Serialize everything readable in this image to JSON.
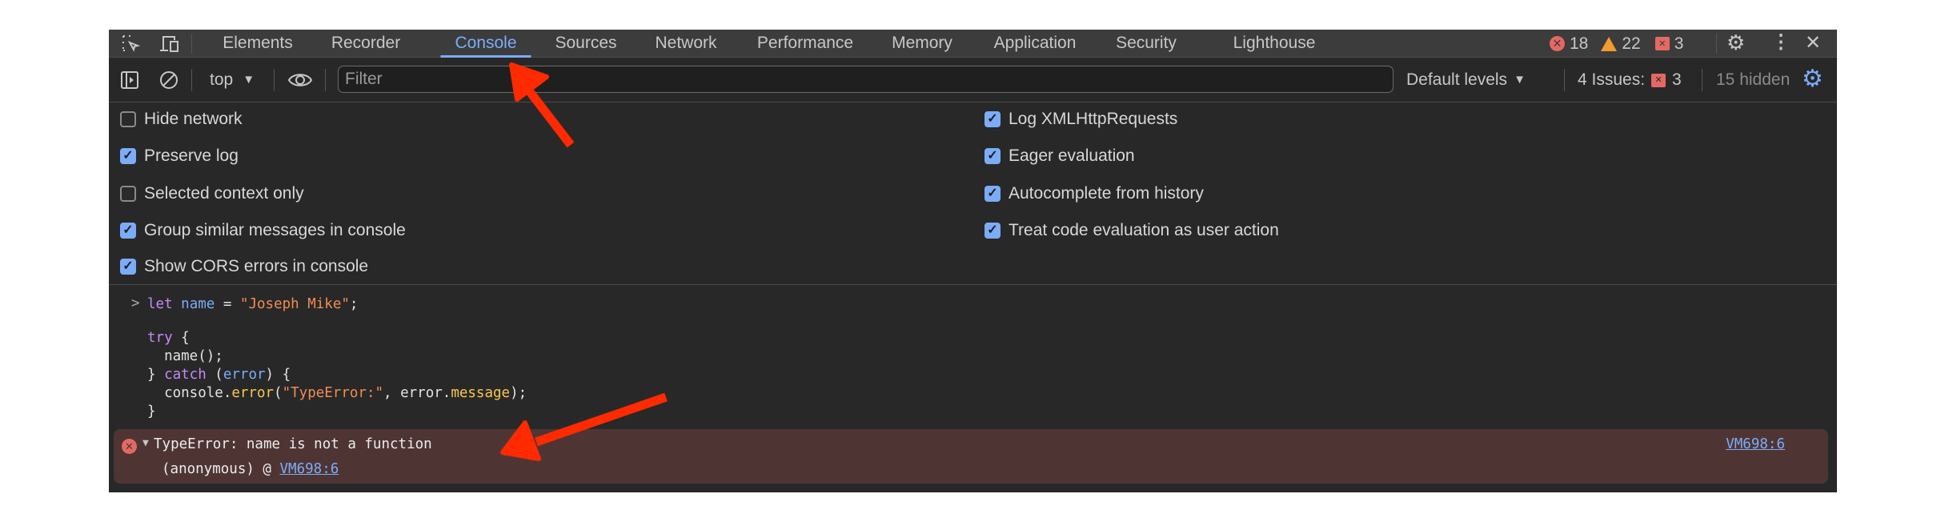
{
  "tabs": [
    {
      "label": "Elements"
    },
    {
      "label": "Recorder"
    },
    {
      "label": "Console",
      "active": true
    },
    {
      "label": "Sources"
    },
    {
      "label": "Network"
    },
    {
      "label": "Performance"
    },
    {
      "label": "Memory"
    },
    {
      "label": "Application"
    },
    {
      "label": "Security"
    },
    {
      "label": "Lighthouse"
    }
  ],
  "counts": {
    "errors": "18",
    "warnings": "22",
    "issues": "3"
  },
  "toolbar": {
    "context": "top",
    "filter_placeholder": "Filter",
    "filter_value": "",
    "levels": "Default levels",
    "issues_label": "4 Issues:",
    "issues_count": "3",
    "hidden": "15 hidden"
  },
  "settings": {
    "left": [
      {
        "label": "Hide network",
        "checked": false
      },
      {
        "label": "Preserve log",
        "checked": true
      },
      {
        "label": "Selected context only",
        "checked": false
      },
      {
        "label": "Group similar messages in console",
        "checked": true
      },
      {
        "label": "Show CORS errors in console",
        "checked": true
      }
    ],
    "right": [
      {
        "label": "Log XMLHttpRequests",
        "checked": true
      },
      {
        "label": "Eager evaluation",
        "checked": true
      },
      {
        "label": "Autocomplete from history",
        "checked": true
      },
      {
        "label": "Treat code evaluation as user action",
        "checked": true
      }
    ]
  },
  "console": {
    "prompt": ">",
    "code": {
      "l1_kw": "let",
      "l1_var": "name",
      "l1_eq": " = ",
      "l1_str": "\"Joseph Mike\"",
      "l1_end": ";",
      "l3_kw": "try",
      "l3_rest": " {",
      "l4": "  name();",
      "l5_a": "} ",
      "l5_kw": "catch",
      "l5_b": " (",
      "l5_var": "error",
      "l5_c": ") {",
      "l6_a": "  console.",
      "l6_fn": "error",
      "l6_b": "(",
      "l6_str": "\"TypeError:\"",
      "l6_c": ", error.",
      "l6_prop": "message",
      "l6_d": ");",
      "l7": "}"
    },
    "error": {
      "message": "TypeError: name is not a function",
      "stack_prefix": "(anonymous) @ ",
      "stack_link": "VM698:6",
      "source_link": "VM698:6"
    }
  },
  "colors": {
    "accent": "#7cacf8",
    "error_bg": "#4e3534",
    "annotation": "#ff2a00"
  }
}
